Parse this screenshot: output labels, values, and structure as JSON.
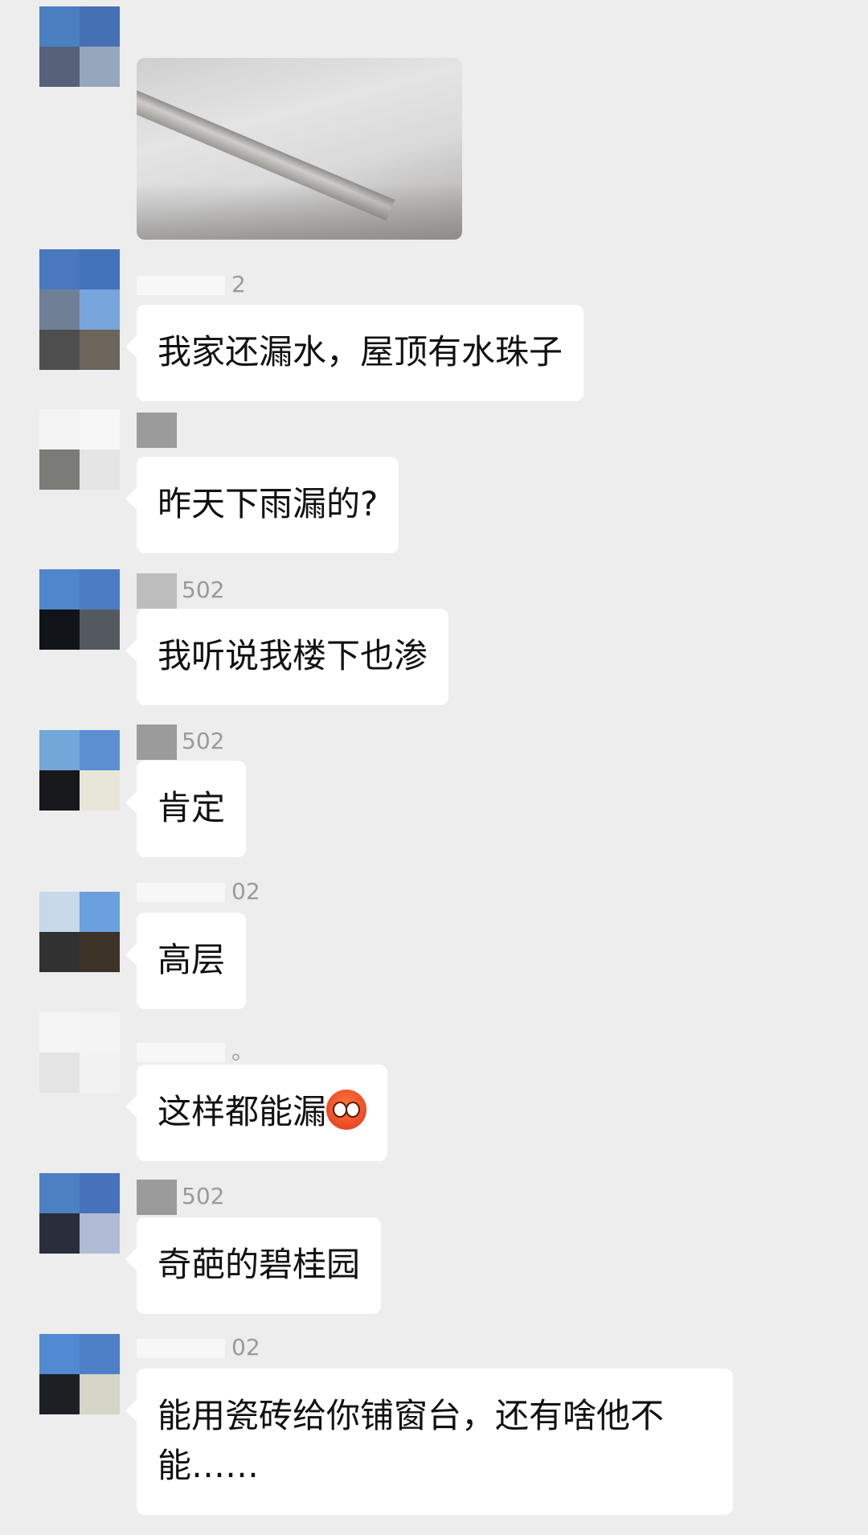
{
  "messages": [
    {
      "nick_suffix": "",
      "text": ""
    },
    {
      "nick_suffix": "2",
      "text": "我家还漏水，屋顶有水珠子"
    },
    {
      "nick_suffix": "",
      "text": "昨天下雨漏的?"
    },
    {
      "nick_suffix": "502",
      "text": "我听说我楼下也渗"
    },
    {
      "nick_suffix": "502",
      "text": "肯定"
    },
    {
      "nick_suffix": "02",
      "text": "高层"
    },
    {
      "nick_suffix": "。",
      "text": "这样都能漏"
    },
    {
      "nick_suffix": "502",
      "text": "奇葩的碧桂园"
    },
    {
      "nick_suffix": "02",
      "text": "能用瓷砖给你铺窗台，还有啥他不能……"
    }
  ],
  "emoji": {
    "name": "flushed-face-emoji"
  },
  "colors": {
    "background": "#ededed",
    "bubble": "#ffffff",
    "nickname": "#9a9a9a"
  }
}
